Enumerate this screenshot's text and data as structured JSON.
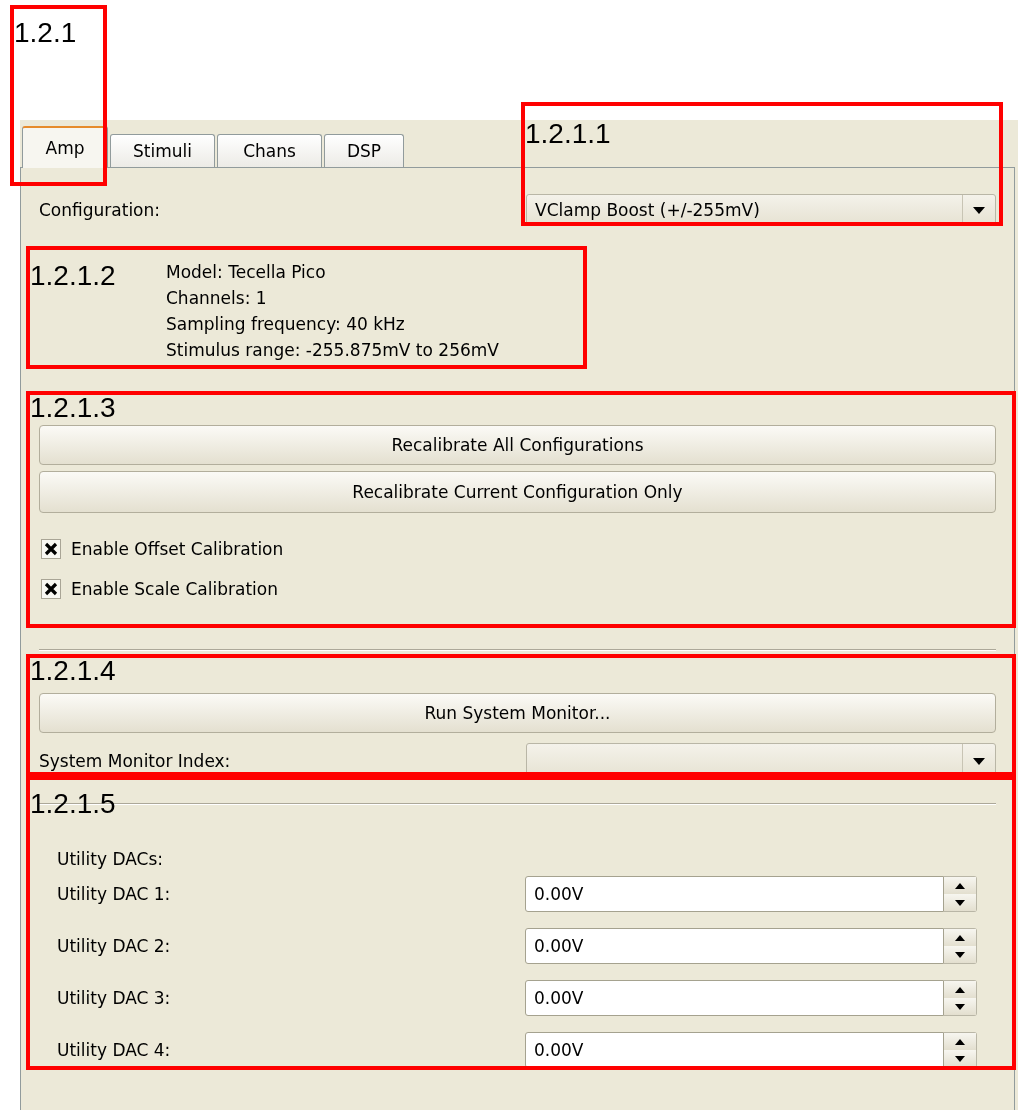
{
  "tabs": [
    {
      "label": "Amp",
      "selected": true
    },
    {
      "label": "Stimuli",
      "selected": false
    },
    {
      "label": "Chans",
      "selected": false
    },
    {
      "label": "DSP",
      "selected": false
    }
  ],
  "configuration": {
    "label": "Configuration:",
    "value": "VClamp Boost (+/-255mV)"
  },
  "device_info": [
    "Model: Tecella Pico",
    "Channels: 1",
    "Sampling frequency: 40 kHz",
    "Stimulus range: -255.875mV to 256mV"
  ],
  "calibration_buttons": [
    "Recalibrate All Configurations",
    "Recalibrate Current Configuration Only"
  ],
  "checkboxes": [
    {
      "label": "Enable Offset Calibration",
      "checked": true
    },
    {
      "label": "Enable Scale Calibration",
      "checked": true
    }
  ],
  "system_monitor": {
    "button": "Run System Monitor...",
    "index_label": "System Monitor Index:"
  },
  "utility_dacs": {
    "heading": "Utility DACs:",
    "items": [
      {
        "label": "Utility DAC 1:",
        "value": "0.00V"
      },
      {
        "label": "Utility DAC 2:",
        "value": "0.00V"
      },
      {
        "label": "Utility DAC 3:",
        "value": "0.00V"
      },
      {
        "label": "Utility DAC 4:",
        "value": "0.00V"
      }
    ]
  },
  "annotations": [
    {
      "label": "1.2.1"
    },
    {
      "label": "1.2.1.1"
    },
    {
      "label": "1.2.1.2"
    },
    {
      "label": "1.2.1.3"
    },
    {
      "label": "1.2.1.4"
    },
    {
      "label": "1.2.1.5"
    }
  ]
}
